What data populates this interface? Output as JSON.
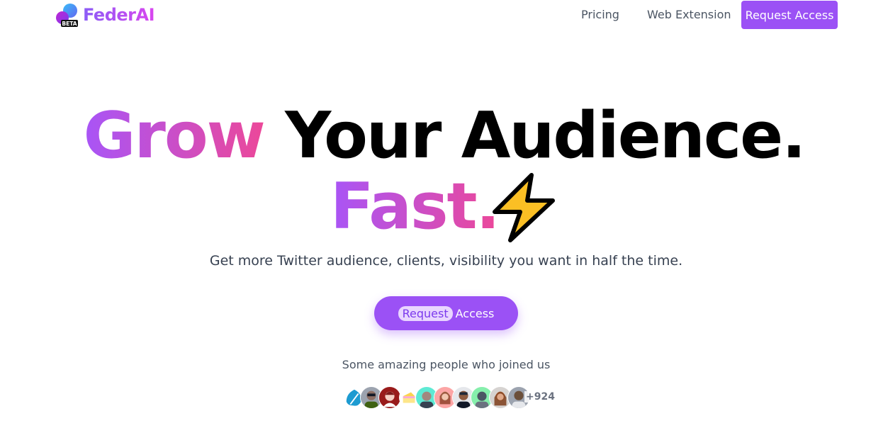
{
  "header": {
    "logo_text": "FederAI",
    "beta_badge": "BETA",
    "nav": {
      "pricing": "Pricing",
      "web_extension": "Web Extension",
      "request_access": "Request Access"
    }
  },
  "hero": {
    "headline_word1": "Grow",
    "headline_rest": "Your Audience.",
    "headline_line2": "Fast.",
    "icon": "lightning-bolt-icon",
    "subtitle": "Get more Twitter audience, clients, visibility you want in half the time.",
    "cta": {
      "highlight": "Request",
      "rest": "Access"
    }
  },
  "social_proof": {
    "caption": "Some amazing people who joined us",
    "more_count": "+924",
    "avatar_count": 10
  },
  "colors": {
    "brand_purple": "#9b51f5",
    "gradient_start": "#a855f7",
    "gradient_end": "#ec4899",
    "bolt_fill": "#fbbf24"
  }
}
